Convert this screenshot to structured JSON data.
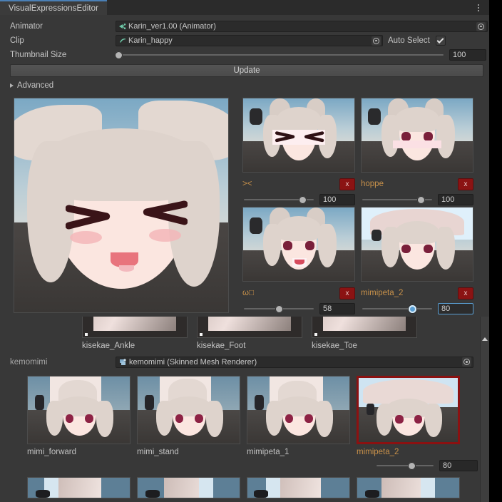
{
  "window": {
    "tab_label": "VisualExpressionsEditor",
    "menu_icon": "kebab-menu-icon"
  },
  "properties": {
    "animator": {
      "label": "Animator",
      "value": "Karin_ver1.00 (Animator)",
      "icon": "animator-icon",
      "picker_icon": "object-picker-icon"
    },
    "clip": {
      "label": "Clip",
      "value": "Karin_happy",
      "icon": "animation-clip-icon",
      "picker_icon": "object-picker-icon",
      "auto_select_label": "Auto Select",
      "auto_select_checked": true
    },
    "thumbnail_size": {
      "label": "Thumbnail Size",
      "value": "100",
      "slider_percent": 1
    }
  },
  "buttons": {
    "update_label": "Update"
  },
  "advanced": {
    "label": "Advanced",
    "expanded": false
  },
  "preview": {
    "name": "main-expression-preview"
  },
  "expression_cards": [
    {
      "name": "><",
      "value": "100",
      "slider_percent": 84,
      "delete_label": "x",
      "active": false
    },
    {
      "name": "hoppe",
      "value": "100",
      "slider_percent": 84,
      "delete_label": "x",
      "active": false
    },
    {
      "name": "ω□",
      "value": "58",
      "slider_percent": 50,
      "delete_label": "x",
      "active": false
    },
    {
      "name": "mimipeta_2",
      "value": "80",
      "slider_percent": 72,
      "delete_label": "x",
      "active": true
    }
  ],
  "lower_section": {
    "kisekae_tiles": [
      {
        "name": "kisekae_Ankle"
      },
      {
        "name": "kisekae_Foot"
      },
      {
        "name": "kisekae_Toe"
      }
    ],
    "group": {
      "name": "kemomimi",
      "object_value": "kemomimi (Skinned Mesh Renderer)",
      "icon": "skinned-mesh-renderer-icon",
      "picker_icon": "object-picker-icon"
    },
    "kemomimi_tiles": [
      {
        "name": "mimi_forward",
        "selected": false
      },
      {
        "name": "mimi_stand",
        "selected": false
      },
      {
        "name": "mimipeta_1",
        "selected": false
      },
      {
        "name": "mimipeta_2",
        "selected": true,
        "value": "80",
        "slider_percent": 62
      }
    ]
  },
  "colors": {
    "accent_blue": "#5a9fd4",
    "label_orange": "#c8914a",
    "delete_red": "#8b1313",
    "selection_red": "#8b1111",
    "panel_bg": "#383838"
  }
}
